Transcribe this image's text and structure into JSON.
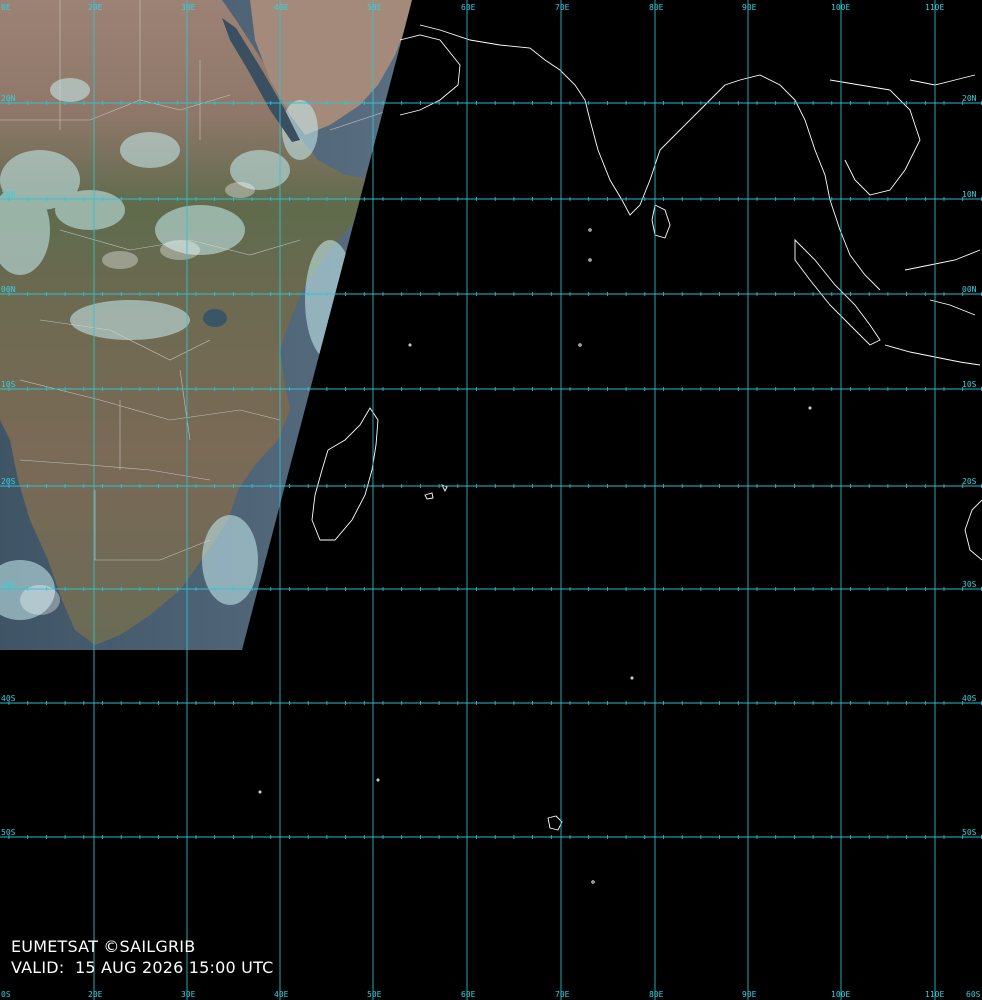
{
  "caption": {
    "provider": "EUMETSAT ©SAILGRIB",
    "valid": "VALID:  15 AUG 2026 15:00 UTC"
  },
  "grid": {
    "longitude_labels": [
      "20E",
      "30E",
      "40E",
      "50E",
      "60E",
      "70E",
      "80E",
      "90E",
      "100E",
      "110E"
    ],
    "latitude_labels_left": [
      "20N",
      "10N",
      "00N",
      "10S",
      "20S",
      "30S",
      "40S",
      "50S"
    ],
    "latitude_labels_right": [
      "20N",
      "10N",
      "00N",
      "10S",
      "20S",
      "30S",
      "40S",
      "50S"
    ],
    "top_left_label": "0E",
    "bottom_left_label": "0S",
    "bottom_right_label": "60S"
  },
  "colors": {
    "grid": "#2ec6d6",
    "ocean": "#000000",
    "coastline": "#ffffff",
    "land_imagery": "#8a7a6c",
    "cloud": "#bfe7ee"
  }
}
